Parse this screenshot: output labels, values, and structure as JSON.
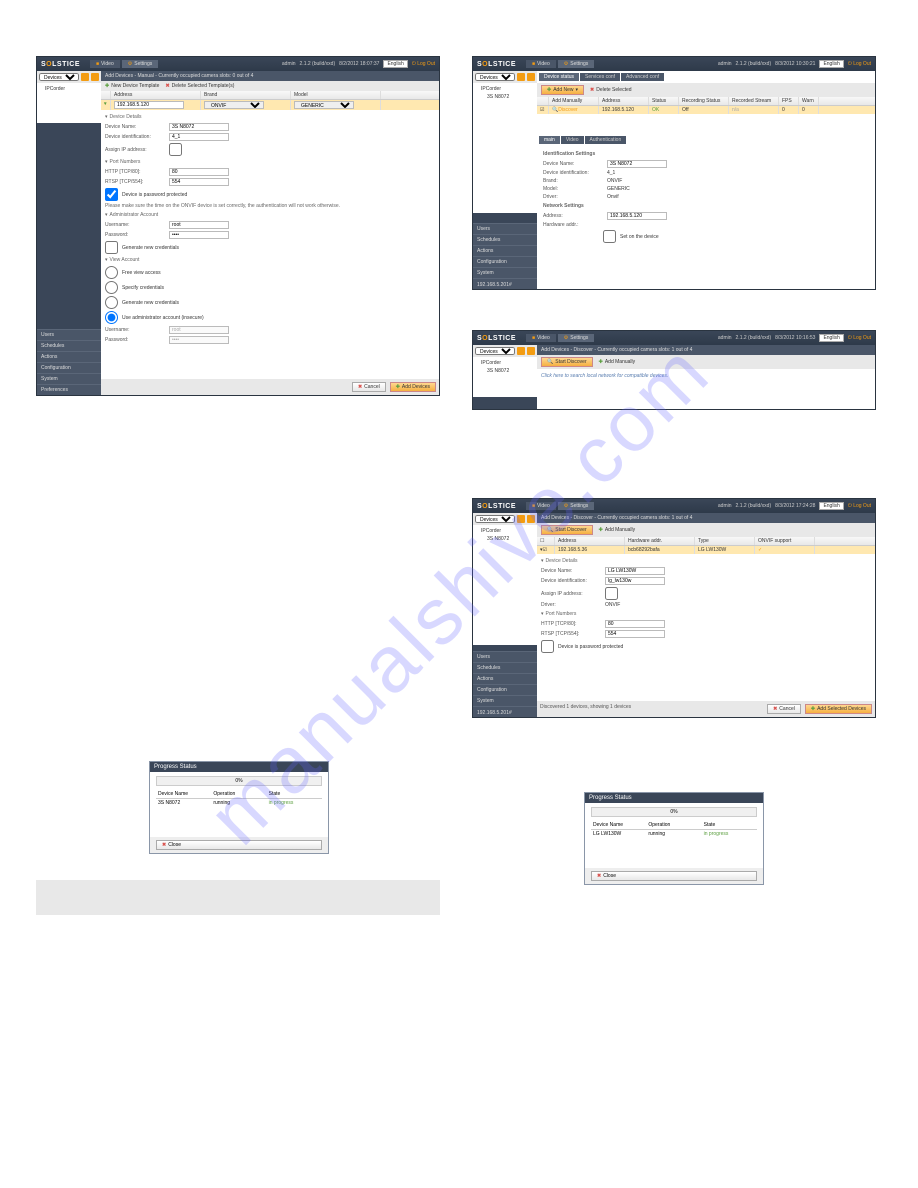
{
  "watermark": "manualshive.com",
  "brand": "SOLSTICE",
  "header": {
    "tab_video": "Video",
    "tab_settings": "Settings",
    "user": "admin",
    "version": "2.1.2 (build/xxd)",
    "lang": "English",
    "logout": "Log Out"
  },
  "timestamps": {
    "p1": "8/2/2012 18:07:37",
    "p2": "8/3/2012 10:30:21",
    "p3": "8/3/2012 10:16:53",
    "p4": "8/3/2012 17:24:28"
  },
  "sidebar": {
    "devices": "Devices",
    "tree_root": "IPCorder",
    "tree_item": "3S N8072",
    "menu": [
      "Users",
      "Schedules",
      "Actions",
      "Configuration",
      "System",
      "Preferences"
    ]
  },
  "panel1": {
    "crumb": "Add Devices - Manual - Currently occupied camera slots: 0 out of 4",
    "btn_new": "New Device Template",
    "btn_del": "Delete Selected Template(s)",
    "g_addr": "Address",
    "g_brand": "Brand",
    "g_model": "Model",
    "ip": "192.168.5.120",
    "brand": "ONVIF",
    "model": "GENERIC",
    "sect_det": "Device Details",
    "lbl_name": "Device Name:",
    "val_name": "3S N8072",
    "lbl_id": "Device identification:",
    "val_id": "4_1",
    "lbl_assign": "Assign IP address:",
    "sect_port": "Port Numbers",
    "lbl_http": "HTTP [TCP/80]:",
    "val_http": "80",
    "lbl_rtsp": "RTSP [TCP/554]:",
    "val_rtsp": "554",
    "chk_pwd": "Device is password protected",
    "note": "Please make sure the time on the ONVIF device is set correctly, the authentication will not work otherwise.",
    "sect_admin": "Administrator Account",
    "lbl_user": "Username:",
    "val_user": "root",
    "lbl_pass": "Password:",
    "val_pass": "••••",
    "chk_gen": "Generate new credentials",
    "sect_view": "View Account",
    "r1": "Free view access",
    "r2": "Specify credentials",
    "r3": "Generate new credentials",
    "r4": "Use administrator account (insecure)",
    "lbl_user2": "Username:",
    "val_user2": "root",
    "lbl_pass2": "Password:",
    "val_pass2": "••••",
    "btn_cancel": "Cancel",
    "btn_add": "Add Devices"
  },
  "panel2": {
    "mtab1": "Device status",
    "mtab2": "Services conf",
    "mtab3": "Advanced conf",
    "btn_addnew": "Add New",
    "btn_del": "Delete Selected",
    "g_addm": "Add Manually",
    "g_addr": "Address",
    "g_status": "Status",
    "g_rec": "Recording Status",
    "g_stream": "Recorded Stream",
    "g_fps": "FPS",
    "g_warn": "Warn",
    "r_disc": "Discover",
    "r_ip": "192.168.5.120",
    "r_status": "OK",
    "r_rec": "Off",
    "r_stream": "n/a",
    "r_fps": "0",
    "r_warn": "0",
    "mt_main": "main",
    "mt_video": "Video",
    "mt_auth": "Authentication",
    "sect_id": "Identification Settings",
    "lbl_name": "Device Name:",
    "val_name": "3S N8072",
    "lbl_id": "Device identification:",
    "val_id": "4_1",
    "lbl_brand": "Brand:",
    "val_brand": "ONVIF",
    "lbl_model": "Model:",
    "val_model": "GENERIC",
    "lbl_drv": "Driver:",
    "val_drv": "Onvif",
    "sect_net": "Network Settings",
    "lbl_addr": "Address:",
    "val_addr": "192.168.5.120",
    "lbl_hw": "Hardware addr.:",
    "chk_set": "Set on the device",
    "status": "192.168.5.201#"
  },
  "panel3": {
    "crumb": "Add Devices - Discover - Currently occupied camera slots: 1 out of 4",
    "btn_start": "Start Discover",
    "btn_addm": "Add Manually",
    "hint": "Click here to search local network for compatible devices."
  },
  "panel4": {
    "crumb": "Add Devices - Discover - Currently occupied camera slots: 1 out of 4",
    "btn_start": "Start Discover",
    "btn_addm": "Add Manually",
    "g_addr": "Address",
    "g_hw": "Hardware addr.",
    "g_type": "Type",
    "g_onvif": "ONVIF support",
    "r_ip": "192.168.5.36",
    "r_hw": "bcb68292bafa",
    "r_type": "LG LW130W",
    "sect_det": "Device Details",
    "lbl_name": "Device Name:",
    "val_name": "LG LW130W",
    "lbl_id": "Device identification:",
    "val_id": "lg_lw130w",
    "lbl_assign": "Assign IP address:",
    "lbl_drv": "Driver:",
    "val_drv": "ONVIF",
    "sect_port": "Port Numbers",
    "lbl_http": "HTTP [TCP/80]:",
    "val_http": "80",
    "lbl_rtsp": "RTSP [TCP/554]:",
    "val_rtsp": "554",
    "chk_pwd": "Device is password protected",
    "footer": "Discovered 1 devices, showing 1 devices",
    "btn_cancel": "Cancel",
    "btn_add": "Add Selected Devices",
    "status": "192.168.5.201#"
  },
  "prog1": {
    "title": "Progress Status",
    "pct": "0%",
    "c1": "Device Name",
    "c2": "Operation",
    "c3": "State",
    "v1": "3S N8072",
    "v2": "running",
    "v3": "in progress",
    "close": "Close"
  },
  "prog2": {
    "title": "Progress Status",
    "pct": "0%",
    "c1": "Device Name",
    "c2": "Operation",
    "c3": "State",
    "v1": "LG LW130W",
    "v2": "running",
    "v3": "in progress",
    "close": "Close"
  }
}
